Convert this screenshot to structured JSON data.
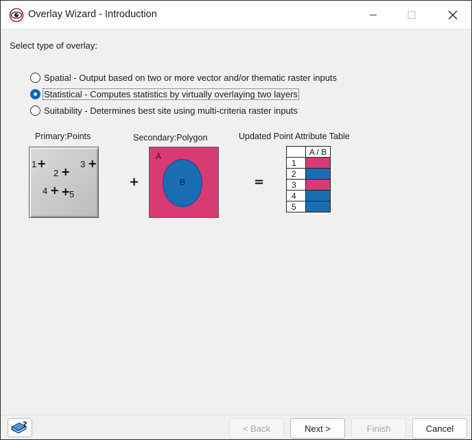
{
  "window": {
    "title": "Overlay Wizard - Introduction"
  },
  "prompt": "Select type of overlay:",
  "options": [
    {
      "label": "Spatial - Output based on two or more vector and/or thematic raster inputs",
      "selected": false
    },
    {
      "label": "Statistical - Computes statistics by virtually overlaying two layers",
      "selected": true
    },
    {
      "label": "Suitability - Determines best site using multi-criteria raster inputs",
      "selected": false
    }
  ],
  "diagram": {
    "primary_label": "Primary:Points",
    "secondary_label": "Secondary:Polygon",
    "result_label": "Updated Point Attribute Table",
    "points": [
      "1",
      "2",
      "3",
      "4",
      "5"
    ],
    "polygon_outer": "A",
    "polygon_inner": "B",
    "plus_operator": "+",
    "equals_operator": "=",
    "table_header": "A / B",
    "table_rows": [
      {
        "id": "1",
        "value": "A"
      },
      {
        "id": "2",
        "value": "B"
      },
      {
        "id": "3",
        "value": "A"
      },
      {
        "id": "4",
        "value": "B"
      },
      {
        "id": "5",
        "value": "B"
      }
    ]
  },
  "colors": {
    "polygon_a": "#d83a74",
    "polygon_b": "#1a6db3",
    "accent": "#0067c0"
  },
  "footer": {
    "help_icon": "help-book-icon",
    "back_label": "< Back",
    "next_label": "Next >",
    "finish_label": "Finish",
    "cancel_label": "Cancel"
  }
}
